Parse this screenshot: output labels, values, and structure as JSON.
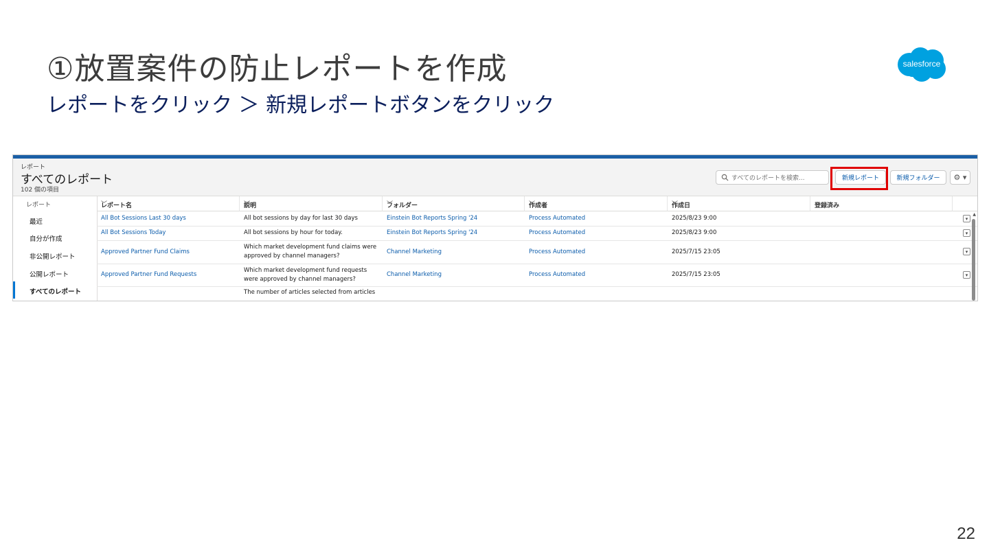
{
  "slide": {
    "title": "①放置案件の防止レポートを作成",
    "subtitle": "レポートをクリック ＞ 新規レポートボタンをクリック",
    "logo_text": "salesforce",
    "page_number": "22"
  },
  "header": {
    "breadcrumb": "レポート",
    "title": "すべてのレポート",
    "count": "102 個の項目",
    "search_placeholder": "すべてのレポートを検索...",
    "new_report_label": "新規レポート",
    "new_folder_label": "新規フォルダー",
    "gear_label": "⚙ ▾"
  },
  "sidebar": {
    "heading": "レポート",
    "items": [
      {
        "label": "最近"
      },
      {
        "label": "自分が作成"
      },
      {
        "label": "非公開レポート"
      },
      {
        "label": "公開レポート"
      },
      {
        "label": "すべてのレポート"
      }
    ]
  },
  "table": {
    "columns": [
      "レポート名",
      "説明",
      "フォルダー",
      "作成者",
      "作成日",
      "登録済み"
    ],
    "rows": [
      {
        "name": "All Bot Sessions Last 30 days",
        "desc": "All bot sessions by day for last 30 days",
        "folder": "Einstein Bot Reports Spring '24",
        "creator": "Process Automated",
        "date": "2025/8/23 9:00"
      },
      {
        "name": "All Bot Sessions Today",
        "desc": "All bot sessions by hour for today.",
        "folder": "Einstein Bot Reports Spring '24",
        "creator": "Process Automated",
        "date": "2025/8/23 9:00"
      },
      {
        "name": "Approved Partner Fund Claims",
        "desc": "Which market development fund claims were approved by channel managers?",
        "folder": "Channel Marketing",
        "creator": "Process Automated",
        "date": "2025/7/15 23:05"
      },
      {
        "name": "Approved Partner Fund Requests",
        "desc": "Which market development fund requests were approved by channel managers?",
        "folder": "Channel Marketing",
        "creator": "Process Automated",
        "date": "2025/7/15 23:05"
      },
      {
        "name": "",
        "desc": "The number of articles selected from articles",
        "folder": "",
        "creator": "",
        "date": ""
      }
    ]
  },
  "colors": {
    "accent": "#0176d3",
    "link": "#0b5cab",
    "highlight": "#e00000",
    "title_blue": "#0b1f5c"
  }
}
